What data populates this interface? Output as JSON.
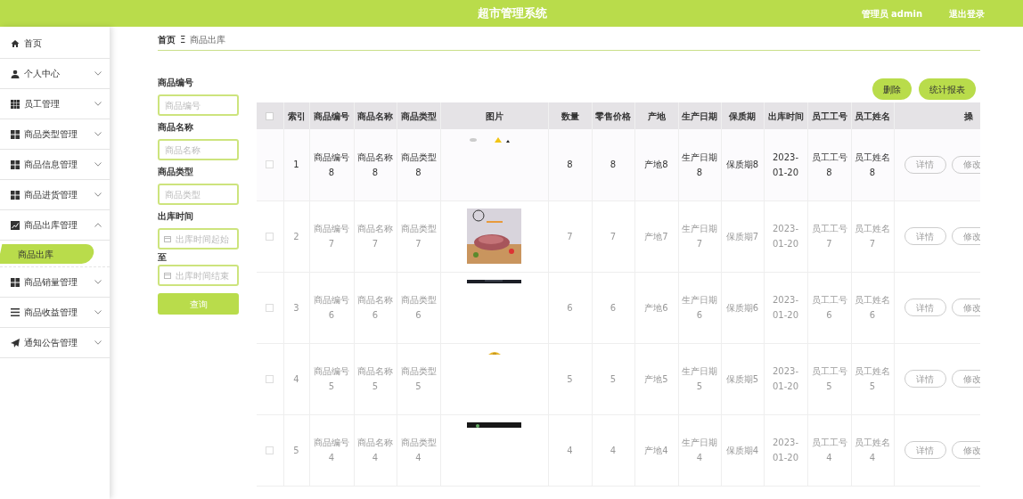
{
  "header": {
    "title": "超市管理系统",
    "user": "管理员 admin",
    "logout": "退出登录"
  },
  "sidebar": {
    "items": [
      {
        "label": "首页"
      },
      {
        "label": "个人中心",
        "expanded": false
      },
      {
        "label": "员工管理",
        "expanded": false
      },
      {
        "label": "商品类型管理",
        "expanded": false
      },
      {
        "label": "商品信息管理",
        "expanded": false
      },
      {
        "label": "商品进货管理",
        "expanded": false
      },
      {
        "label": "商品出库管理",
        "expanded": true,
        "children": [
          {
            "label": "商品出库",
            "selected": true
          }
        ]
      },
      {
        "label": "商品销量管理",
        "expanded": false
      },
      {
        "label": "商品收益管理",
        "expanded": false
      },
      {
        "label": "通知公告管理",
        "expanded": false
      }
    ]
  },
  "breadcrumb": {
    "home": "首页",
    "separator": "Ξ",
    "current": "商品出库"
  },
  "filters": [
    {
      "label": "商品编号",
      "placeholder": "商品编号",
      "kind": "text"
    },
    {
      "label": "商品名称",
      "placeholder": "商品名称",
      "kind": "text"
    },
    {
      "label": "商品类型",
      "placeholder": "商品类型",
      "kind": "text"
    },
    {
      "label": "出库时间",
      "placeholder": "出库时间起始",
      "kind": "date"
    },
    {
      "label": "至",
      "placeholder": "出库时间结束",
      "kind": "date"
    }
  ],
  "search_button": "查询",
  "actions": [
    "删除",
    "统计报表"
  ],
  "table": {
    "select_all_checked": false,
    "columns": [
      "索引",
      "商品编号",
      "商品名称",
      "商品类型",
      "图片",
      "数量",
      "零售价格",
      "产地",
      "生产日期",
      "保质期",
      "出库时间",
      "员工工号",
      "员工姓名",
      "操"
    ],
    "rows": [
      {
        "checked": false,
        "hovered": true,
        "cells": [
          "1",
          "商品编号8",
          "商品名称8",
          "商品类型8",
          "",
          "8",
          "8",
          "产地8",
          "生产日期8",
          "保质期8",
          "2023-01-20",
          "员工工号8",
          "员工姓名8"
        ],
        "buttons": [
          "详情",
          "修改"
        ]
      },
      {
        "checked": false,
        "hovered": false,
        "cells": [
          "2",
          "商品编号7",
          "商品名称7",
          "商品类型7",
          "",
          "7",
          "7",
          "产地7",
          "生产日期7",
          "保质期7",
          "2023-01-20",
          "员工工号7",
          "员工姓名7"
        ],
        "buttons": [
          "详情",
          "修改"
        ]
      },
      {
        "checked": false,
        "hovered": false,
        "cells": [
          "3",
          "商品编号6",
          "商品名称6",
          "商品类型6",
          "",
          "6",
          "6",
          "产地6",
          "生产日期6",
          "保质期6",
          "2023-01-20",
          "员工工号6",
          "员工姓名6"
        ],
        "buttons": [
          "详情",
          "修改"
        ]
      },
      {
        "checked": false,
        "hovered": false,
        "cells": [
          "4",
          "商品编号5",
          "商品名称5",
          "商品类型5",
          "",
          "5",
          "5",
          "产地5",
          "生产日期5",
          "保质期5",
          "2023-01-20",
          "员工工号5",
          "员工姓名5"
        ],
        "buttons": [
          "详情",
          "修改"
        ]
      },
      {
        "checked": false,
        "hovered": false,
        "cells": [
          "5",
          "商品编号4",
          "商品名称4",
          "商品类型4",
          "",
          "4",
          "4",
          "产地4",
          "生产日期4",
          "保质期4",
          "2023-01-20",
          "员工工号4",
          "员工姓名4"
        ],
        "buttons": [
          "详情",
          "修改"
        ]
      }
    ]
  }
}
